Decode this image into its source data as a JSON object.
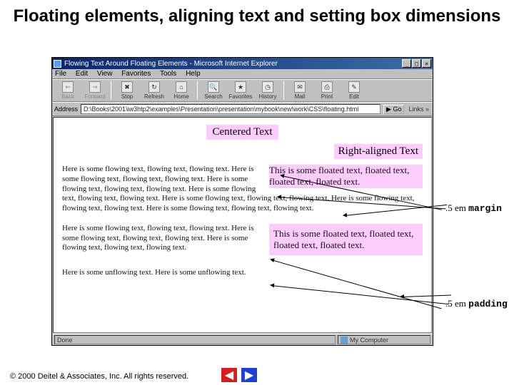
{
  "title": "Floating elements, aligning text and setting box dimensions",
  "ie": {
    "window_title": "Flowing Text Around Floating Elements - Microsoft Internet Explorer",
    "menu": {
      "file": "File",
      "edit": "Edit",
      "view": "View",
      "favorites": "Favorites",
      "tools": "Tools",
      "help": "Help"
    },
    "toolbar": {
      "back": "Back",
      "forward": "Forward",
      "stop": "Stop",
      "refresh": "Refresh",
      "home": "Home",
      "search": "Search",
      "favorites": "Favorites",
      "history": "History",
      "mail": "Mail",
      "print": "Print",
      "edit": "Edit"
    },
    "addr_label": "Address",
    "addr_value": "D:\\Books\\2001\\iw3htp2\\examples\\Presentation\\presentation\\mybook\\new\\work\\CSS\\floating.html",
    "go": "Go",
    "links": "Links",
    "status_left": "Done",
    "status_right": "My Computer"
  },
  "content": {
    "centered": "Centered Text",
    "right": "Right-aligned Text",
    "float1": "This is some floated text, floated text, floated text, floated text.",
    "flow1": "Here is some flowing text, flowing text, flowing text. Here is some flowing text, flowing text, flowing text. Here is some flowing text, flowing text, flowing text. Here is some flowing text, flowing text, flowing text. Here is some flowing text, flowing text, flowing text. Here is some flowing text, flowing text, flowing text. Here is some flowing text, flowing text, flowing text.",
    "float2": "This is some floated text, floated text, floated text, floated text.",
    "flow2": "Here is some flowing text, flowing text, flowing text. Here is some flowing text, flowing text, flowing text. Here is some flowing text, flowing text, flowing text.",
    "unflow": "Here is some unflowing text. Here is some unflowing text."
  },
  "annos": {
    "margin_prefix": ".5 em ",
    "margin_kw": "margin",
    "padding_prefix": ".5 em ",
    "padding_kw": "padding"
  },
  "footer": {
    "copyright": "© 2000 Deitel & Associates, Inc. All rights reserved."
  }
}
